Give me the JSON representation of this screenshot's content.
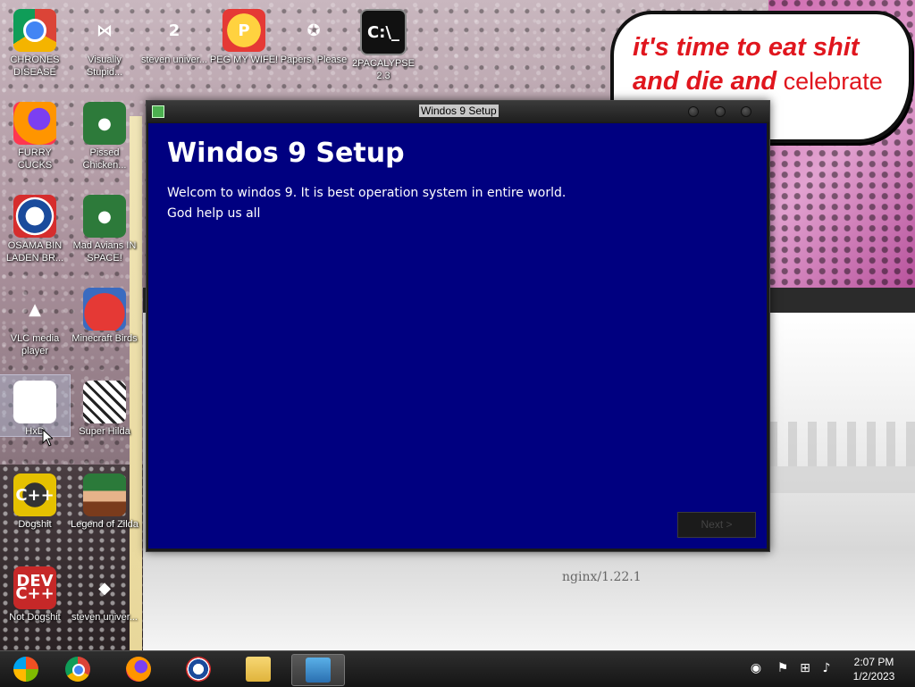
{
  "wallpaper": {
    "bubble_line1": "it's time to eat shit",
    "bubble_line2_bold": "and die and",
    "bubble_line2_thin": " celebrate"
  },
  "desktop_icons": [
    {
      "label": "CHRONES DISEASE",
      "icon": "chrome-icon"
    },
    {
      "label": "Visually Stupid...",
      "icon": "visual-studio-icon"
    },
    {
      "label": "steven univer...",
      "icon": "steven-universe-icon"
    },
    {
      "label": "PEG MY WIFE!",
      "icon": "peggle-icon"
    },
    {
      "label": "Papers, Please",
      "icon": "papers-please-icon"
    },
    {
      "label": "2PACALYPSE 2.3",
      "icon": "cmd-icon"
    },
    {
      "label": "FURRY CUCKS",
      "icon": "firefox-icon"
    },
    {
      "label": "Pissed Chicken...",
      "icon": "angry-birds-seasons-icon"
    },
    {
      "label": "OSAMA BIN LADEN BR...",
      "icon": "obama-logo-icon"
    },
    {
      "label": "Mad Avians IN SPACE!",
      "icon": "angry-birds-space-icon"
    },
    {
      "label": "VLC media player",
      "icon": "vlc-icon"
    },
    {
      "label": "Minecraft Birds",
      "icon": "angry-birds-icon"
    },
    {
      "label": "HxD",
      "icon": "hxd-icon"
    },
    {
      "label": "Super Hilda",
      "icon": "super-hilda-icon"
    },
    {
      "label": "Dogshit",
      "icon": "cpp-icon"
    },
    {
      "label": "Legend of Zilda",
      "icon": "zelda-icon"
    },
    {
      "label": "Not Dogshit",
      "icon": "dev-cpp-icon"
    },
    {
      "label": "steven univer...",
      "icon": "diamond-icon"
    }
  ],
  "background_browser": {
    "server_text": "nginx/1.22.1"
  },
  "setup_window": {
    "title": "Windos 9 Setup",
    "heading": "Windos 9 Setup",
    "line1": "Welcom to windos 9. It is best operation system in entire world.",
    "line2": "God help us all",
    "next_label": "Next >",
    "body_color": "#000080"
  },
  "taskbar": {
    "items": [
      "start-orb-icon",
      "chrome-icon",
      "firefox-icon",
      "obama-logo-icon",
      "file-explorer-icon",
      "setup-icon"
    ],
    "time": "2:07 PM",
    "date": "1/2/2023"
  }
}
